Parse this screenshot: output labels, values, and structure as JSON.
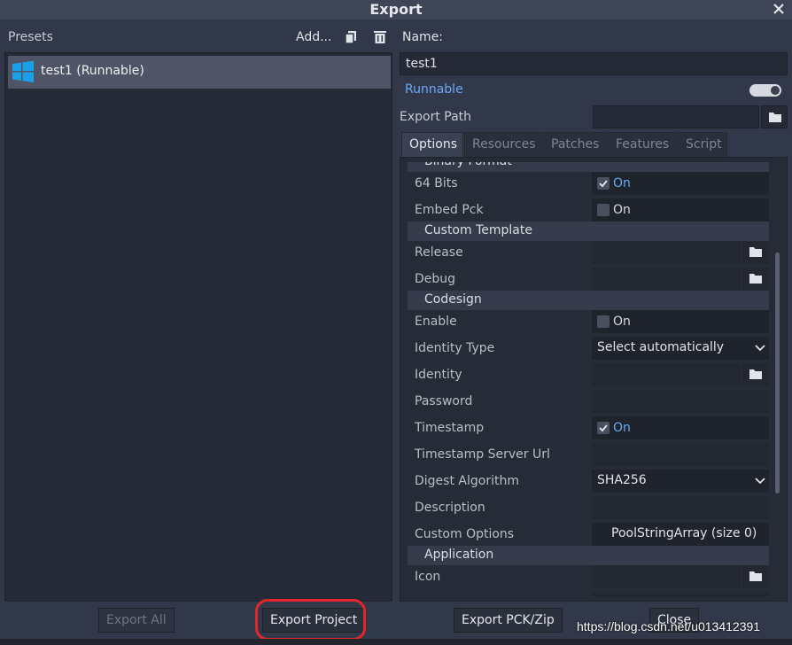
{
  "window": {
    "title": "Export"
  },
  "presets": {
    "label": "Presets",
    "add_label": "Add...",
    "items": [
      {
        "name": "test1 (Runnable)",
        "icon": "windows-logo-icon"
      }
    ]
  },
  "details": {
    "name_label": "Name:",
    "name_value": "test1",
    "runnable_label": "Runnable",
    "runnable_on": true,
    "export_path_label": "Export Path",
    "export_path_value": ""
  },
  "tabs": [
    "Options",
    "Resources",
    "Patches",
    "Features",
    "Script"
  ],
  "active_tab": "Options",
  "options": {
    "binary_format_header": "Binary Format",
    "bits64_label": "64 Bits",
    "bits64_value": "On",
    "embed_pck_label": "Embed Pck",
    "embed_pck_value": "On",
    "custom_template_header": "Custom Template",
    "release_label": "Release",
    "debug_label": "Debug",
    "codesign_header": "Codesign",
    "enable_label": "Enable",
    "enable_value": "On",
    "identity_type_label": "Identity Type",
    "identity_type_value": "Select automatically",
    "identity_label": "Identity",
    "password_label": "Password",
    "timestamp_label": "Timestamp",
    "timestamp_value": "On",
    "timestamp_url_label": "Timestamp Server Url",
    "digest_label": "Digest Algorithm",
    "digest_value": "SHA256",
    "description_label": "Description",
    "custom_options_label": "Custom Options",
    "custom_options_value": "PoolStringArray (size 0)",
    "application_header": "Application",
    "icon_label": "Icon"
  },
  "buttons": {
    "export_all": "Export All",
    "export_project": "Export Project",
    "export_pck": "Export PCK/Zip",
    "close": "Close"
  },
  "watermark": "https://blog.csdn.net/u013412391",
  "colors": {
    "accent": "#6aa9f4",
    "highlight": "#e3262b",
    "windows_blue": "#1aa0e6"
  }
}
